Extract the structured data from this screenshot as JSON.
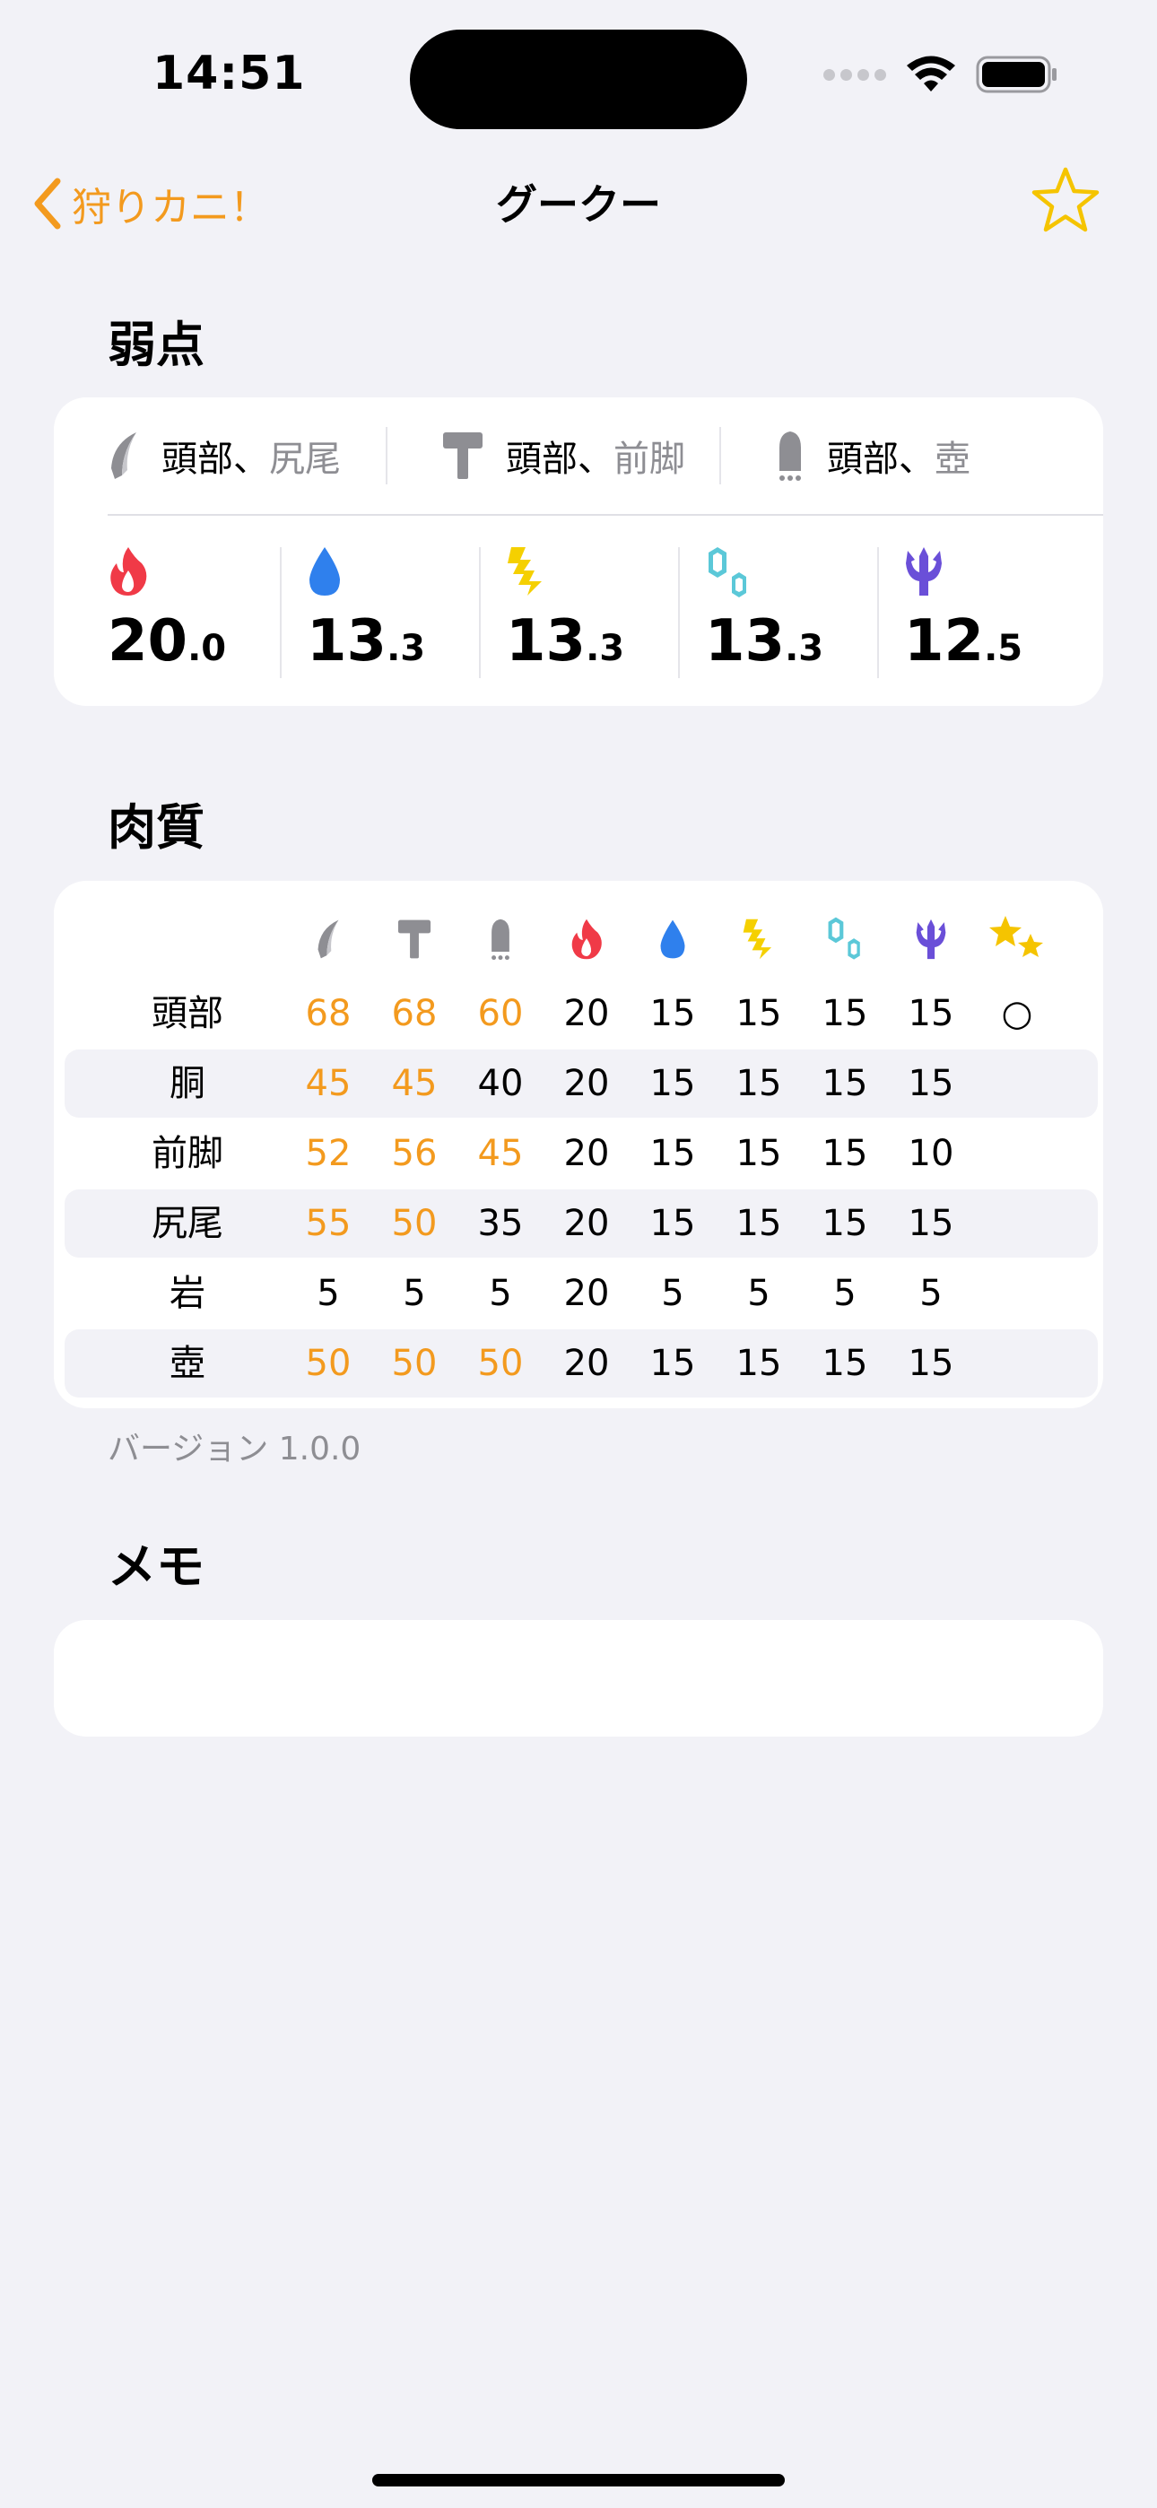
{
  "status_bar": {
    "time": "14:51"
  },
  "nav": {
    "back_label": "狩りカニ！",
    "title": "グークー"
  },
  "weakness": {
    "title": "弱点",
    "weapon_types": [
      {
        "icon": "sever-icon",
        "primary": "頭部、",
        "secondary": "尻尾"
      },
      {
        "icon": "blunt-icon",
        "primary": "頭部、",
        "secondary": "前脚"
      },
      {
        "icon": "shot-icon",
        "primary": "頭部、",
        "secondary": "壺"
      }
    ],
    "elements": [
      {
        "icon": "fire-icon",
        "int": "20",
        "dec": ".0",
        "color": "#F03A47"
      },
      {
        "icon": "water-icon",
        "int": "13",
        "dec": ".3",
        "color": "#2F80ED"
      },
      {
        "icon": "thunder-icon",
        "int": "13",
        "dec": ".3",
        "color": "#F5D000"
      },
      {
        "icon": "ice-icon",
        "int": "13",
        "dec": ".3",
        "color": "#5BC8D8"
      },
      {
        "icon": "dragon-icon",
        "int": "12",
        "dec": ".5",
        "color": "#6A4FD8"
      }
    ]
  },
  "hitzones": {
    "title": "肉質",
    "columns": [
      "sever-icon",
      "blunt-icon",
      "shot-icon",
      "fire-icon",
      "water-icon",
      "thunder-icon",
      "ice-icon",
      "dragon-icon",
      "stun-icon"
    ],
    "rows": [
      {
        "part": "頭部",
        "values": [
          "68",
          "68",
          "60",
          "20",
          "15",
          "15",
          "15",
          "15",
          "○"
        ],
        "highlight": [
          true,
          true,
          true,
          false,
          false,
          false,
          false,
          false,
          false
        ]
      },
      {
        "part": "胴",
        "values": [
          "45",
          "45",
          "40",
          "20",
          "15",
          "15",
          "15",
          "15",
          ""
        ],
        "highlight": [
          true,
          true,
          false,
          false,
          false,
          false,
          false,
          false,
          false
        ]
      },
      {
        "part": "前脚",
        "values": [
          "52",
          "56",
          "45",
          "20",
          "15",
          "15",
          "15",
          "10",
          ""
        ],
        "highlight": [
          true,
          true,
          true,
          false,
          false,
          false,
          false,
          false,
          false
        ]
      },
      {
        "part": "尻尾",
        "values": [
          "55",
          "50",
          "35",
          "20",
          "15",
          "15",
          "15",
          "15",
          ""
        ],
        "highlight": [
          true,
          true,
          false,
          false,
          false,
          false,
          false,
          false,
          false
        ]
      },
      {
        "part": "岩",
        "values": [
          "5",
          "5",
          "5",
          "20",
          "5",
          "5",
          "5",
          "5",
          ""
        ],
        "highlight": [
          false,
          false,
          false,
          false,
          false,
          false,
          false,
          false,
          false
        ]
      },
      {
        "part": "壺",
        "values": [
          "50",
          "50",
          "50",
          "20",
          "15",
          "15",
          "15",
          "15",
          ""
        ],
        "highlight": [
          true,
          true,
          true,
          false,
          false,
          false,
          false,
          false,
          false
        ]
      }
    ],
    "version": "バージョン 1.0.0"
  },
  "memo": {
    "title": "メモ",
    "value": ""
  },
  "colors": {
    "accent": "#F39A1E",
    "background": "#F2F2F7",
    "card": "#FFFFFF"
  }
}
